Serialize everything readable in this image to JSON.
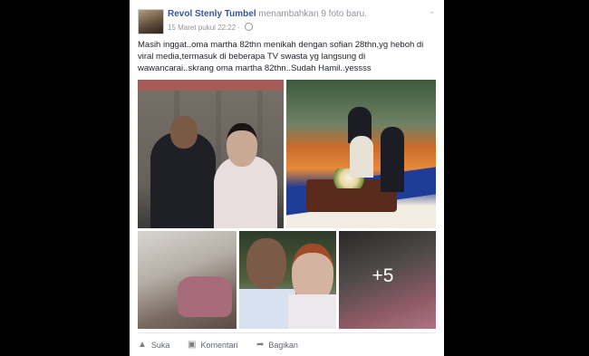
{
  "post": {
    "author": "Revol Stenly Tumbel",
    "action": "menambahkan 9 foto baru.",
    "timestamp": "15 Maret pukul 22:22",
    "separator": "·",
    "text": "Masih inggat..oma martha 82thn menikah dengan sofian 28thn,yg heboh di viral media,termasuk di beberapa TV swasta yg langsung di wawancarai..skrang oma martha 82thn..Sudah Hamil..yessss",
    "photo_overflow": "+5"
  },
  "actions": {
    "like": "Suka",
    "comment": "Komentari",
    "share": "Bagikan"
  },
  "icons": {
    "options": "chevron-down-icon",
    "privacy": "globe-icon",
    "like": "thumbs-up-icon",
    "comment": "comment-icon",
    "share": "share-icon"
  },
  "colors": {
    "author": "#365899",
    "meta": "#90949c",
    "text": "#1d2129",
    "background": "#000000"
  }
}
